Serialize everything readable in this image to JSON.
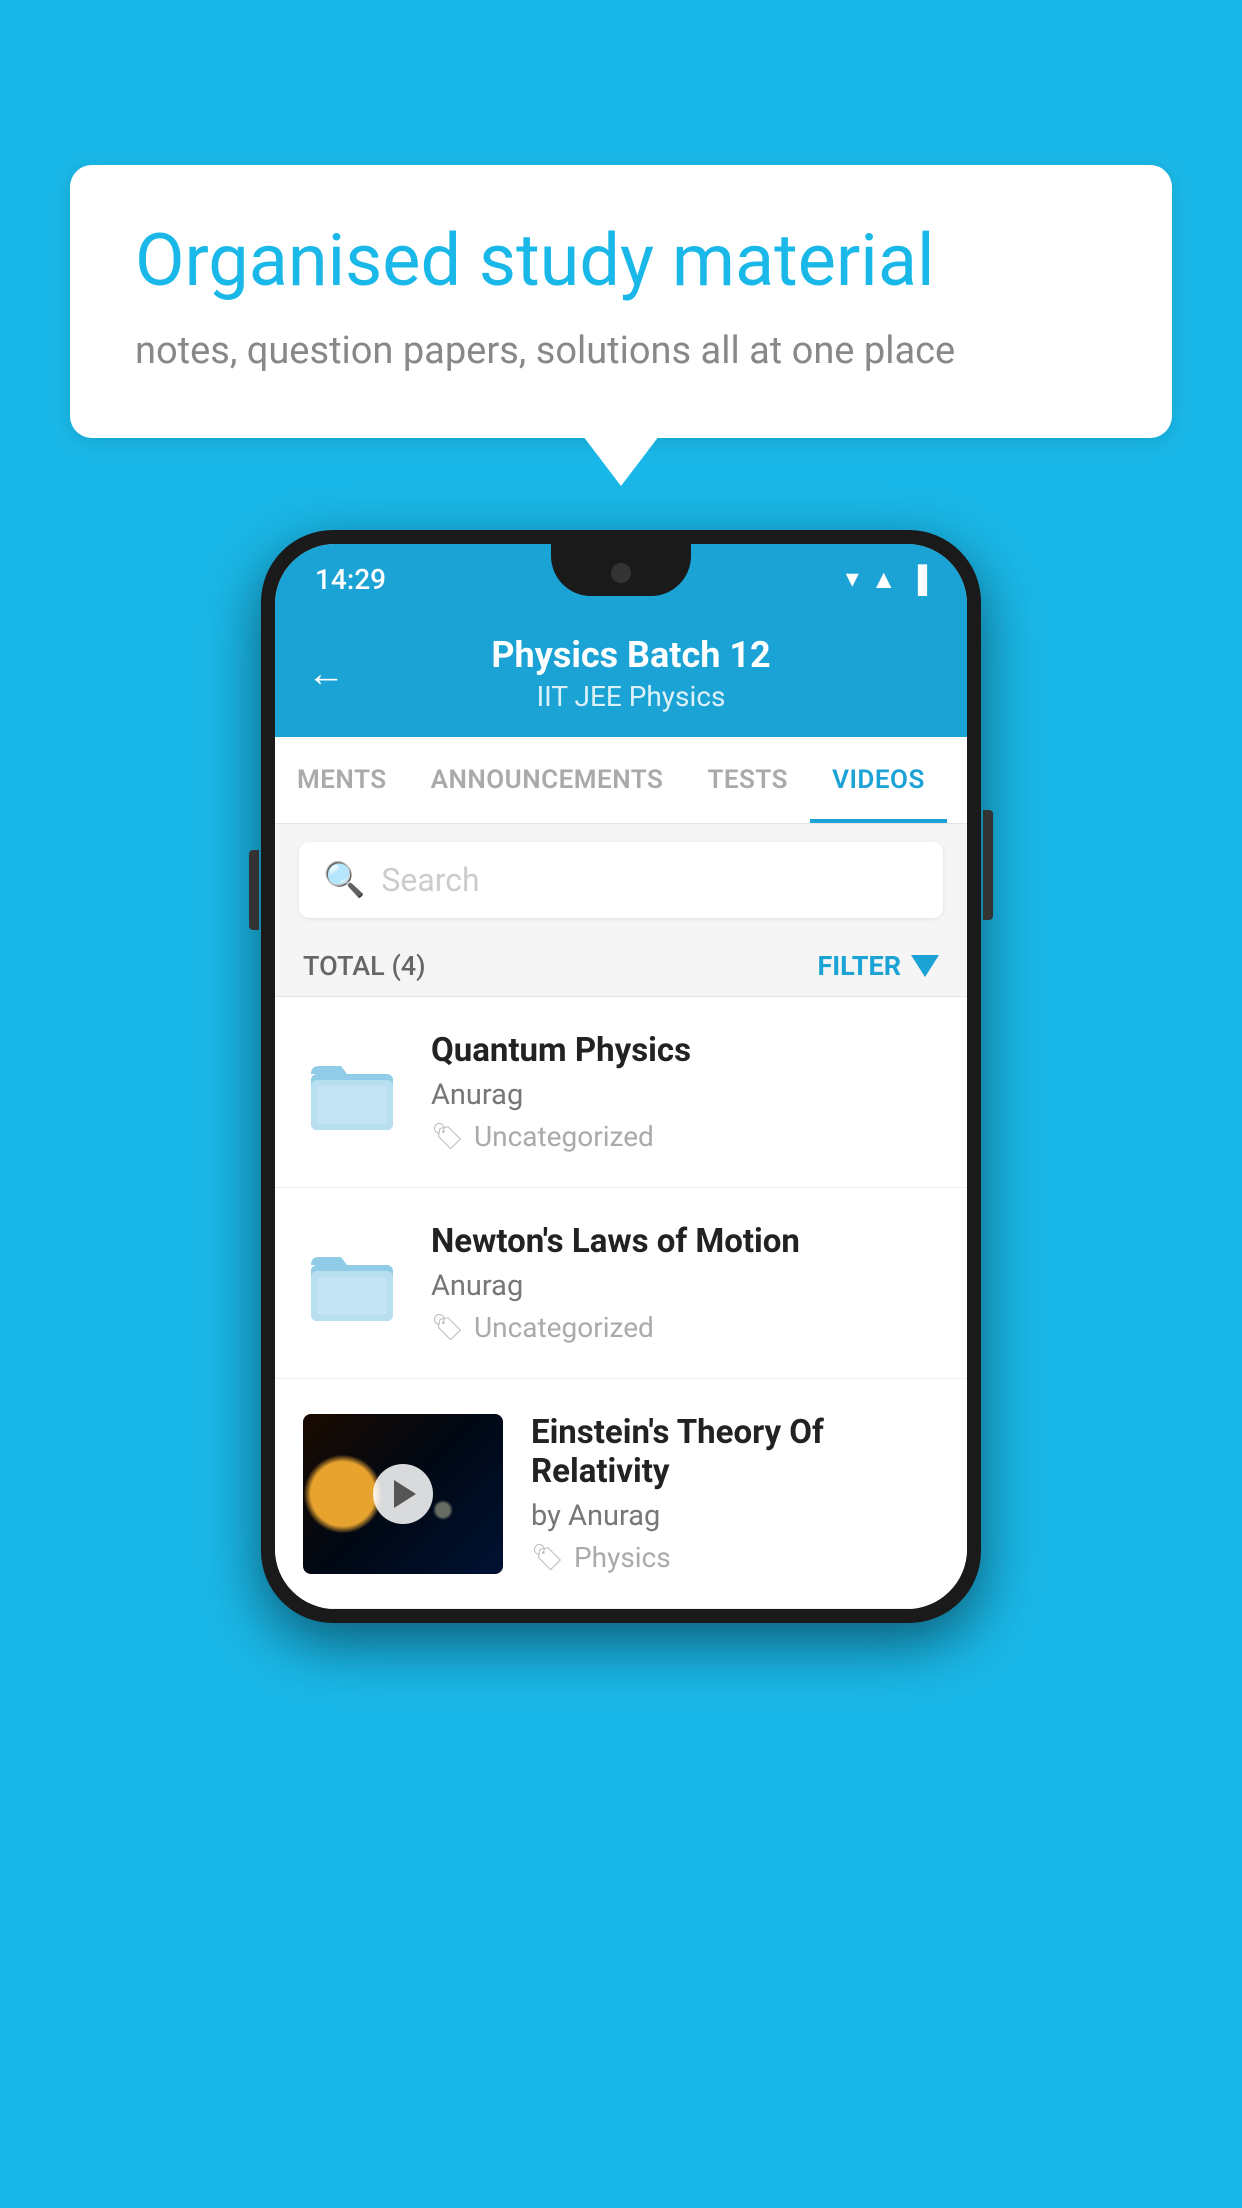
{
  "background": {
    "color": "#1ab8e8"
  },
  "speech_bubble": {
    "title": "Organised study material",
    "subtitle": "notes, question papers, solutions all at one place"
  },
  "phone": {
    "status_bar": {
      "time": "14:29",
      "wifi": "▼",
      "signal": "▲",
      "battery": "▐"
    },
    "header": {
      "back_label": "←",
      "title": "Physics Batch 12",
      "subtitle": "IIT JEE   Physics"
    },
    "tabs": [
      {
        "label": "MENTS",
        "active": false
      },
      {
        "label": "ANNOUNCEMENTS",
        "active": false
      },
      {
        "label": "TESTS",
        "active": false
      },
      {
        "label": "VIDEOS",
        "active": true
      }
    ],
    "search": {
      "placeholder": "Search"
    },
    "filter_row": {
      "total_label": "TOTAL (4)",
      "filter_label": "FILTER"
    },
    "videos": [
      {
        "id": 1,
        "title": "Quantum Physics",
        "author": "Anurag",
        "tag": "Uncategorized",
        "type": "folder"
      },
      {
        "id": 2,
        "title": "Newton's Laws of Motion",
        "author": "Anurag",
        "tag": "Uncategorized",
        "type": "folder"
      },
      {
        "id": 3,
        "title": "Einstein's Theory Of Relativity",
        "author": "by Anurag",
        "tag": "Physics",
        "type": "video"
      }
    ]
  }
}
